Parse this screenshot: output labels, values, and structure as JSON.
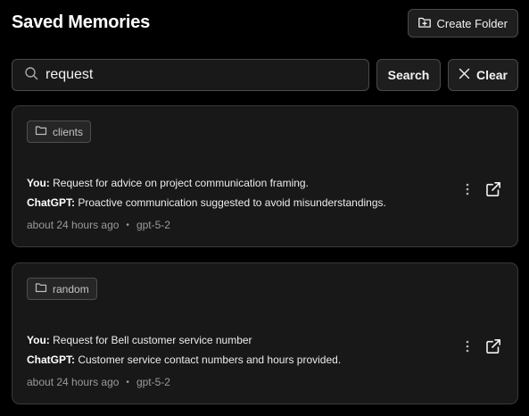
{
  "header": {
    "title": "Saved Memories",
    "create_folder_label": "Create Folder"
  },
  "search": {
    "value": "request",
    "search_label": "Search",
    "clear_label": "Clear"
  },
  "memories": [
    {
      "folder": "clients",
      "you_label": "You:",
      "you_text": "Request for advice on project communication framing.",
      "gpt_label": "ChatGPT:",
      "gpt_text": "Proactive communication suggested to avoid misunderstandings.",
      "time": "about 24 hours ago",
      "separator": "•",
      "model": "gpt-5-2"
    },
    {
      "folder": "random",
      "you_label": "You:",
      "you_text": "Request for Bell customer service number",
      "gpt_label": "ChatGPT:",
      "gpt_text": "Customer service contact numbers and hours provided.",
      "time": "about 24 hours ago",
      "separator": "•",
      "model": "gpt-5-2"
    }
  ],
  "icons": {
    "create_folder": "folder-plus-icon",
    "search": "search-icon",
    "clear": "close-icon",
    "folder": "folder-icon",
    "more": "more-vertical-icon",
    "open": "external-link-icon"
  },
  "colors": {
    "background": "#000000",
    "card": "#181818",
    "border": "#3a3a3a",
    "text": "#ececec",
    "muted": "#9a9a9a"
  }
}
